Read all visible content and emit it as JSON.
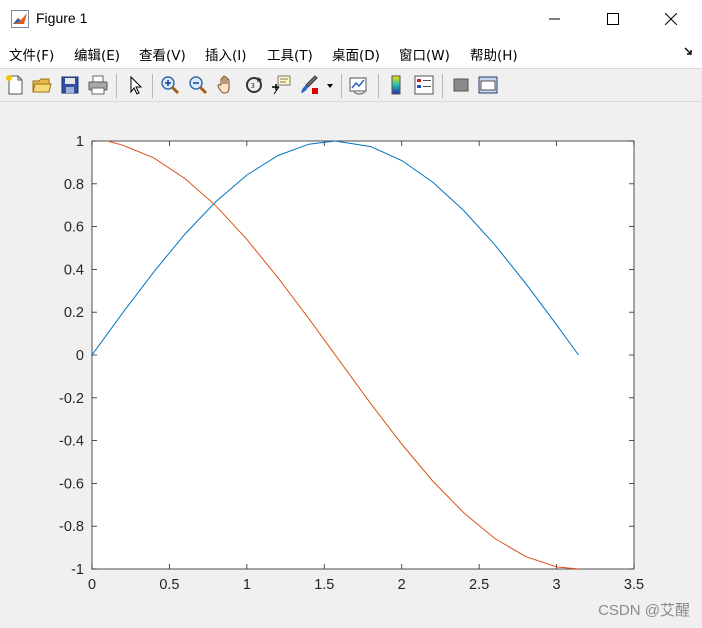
{
  "window": {
    "title": "Figure 1",
    "minimize_glyph": "—",
    "maximize_glyph": "☐",
    "close_glyph": "✕"
  },
  "menu": {
    "items": [
      "文件(F)",
      "编辑(E)",
      "查看(V)",
      "插入(I)",
      "工具(T)",
      "桌面(D)",
      "窗口(W)",
      "帮助(H)"
    ],
    "overflow_icon": "dock-arrow-icon"
  },
  "toolbar": {
    "icons": [
      "new-figure-icon",
      "open-file-icon",
      "save-icon",
      "print-icon",
      "select-pointer-icon",
      "zoom-in-icon",
      "zoom-out-icon",
      "pan-hand-icon",
      "rotate-3d-icon",
      "data-cursor-icon",
      "brush-icon",
      "link-plot-icon",
      "colorbar-icon",
      "legend-icon",
      "hide-plot-tools-icon",
      "show-plot-tools-icon"
    ]
  },
  "chart_data": {
    "type": "line",
    "title": "",
    "xlabel": "",
    "ylabel": "",
    "xlim": [
      0,
      3.5
    ],
    "ylim": [
      -1,
      1
    ],
    "xticks": [
      "0",
      "0.5",
      "1",
      "1.5",
      "2",
      "2.5",
      "3",
      "3.5"
    ],
    "yticks": [
      "1",
      "0.8",
      "0.6",
      "0.4",
      "0.2",
      "0",
      "-0.2",
      "-0.4",
      "-0.6",
      "-0.8",
      "-1"
    ],
    "grid": false,
    "series": [
      {
        "color": "#0072bd",
        "x": [
          0,
          0.2,
          0.4,
          0.6,
          0.8,
          1.0,
          1.2,
          1.4,
          1.5708,
          1.8,
          2.0,
          2.2,
          2.4,
          2.6,
          2.8,
          3.0,
          3.1416
        ],
        "y": [
          0,
          0.199,
          0.389,
          0.565,
          0.717,
          0.841,
          0.932,
          0.985,
          1.0,
          0.974,
          0.909,
          0.808,
          0.675,
          0.516,
          0.335,
          0.141,
          0
        ]
      },
      {
        "color": "#d95319",
        "x": [
          0.1,
          0.2,
          0.4,
          0.6,
          0.8,
          1.0,
          1.2,
          1.4,
          1.6,
          1.8,
          2.0,
          2.2,
          2.4,
          2.6,
          2.8,
          3.0,
          3.1416
        ],
        "y": [
          1.0,
          0.98,
          0.921,
          0.825,
          0.697,
          0.54,
          0.362,
          0.17,
          -0.029,
          -0.227,
          -0.416,
          -0.589,
          -0.737,
          -0.857,
          -0.942,
          -0.99,
          -1.0
        ]
      }
    ]
  },
  "watermark": "CSDN @艾醒"
}
